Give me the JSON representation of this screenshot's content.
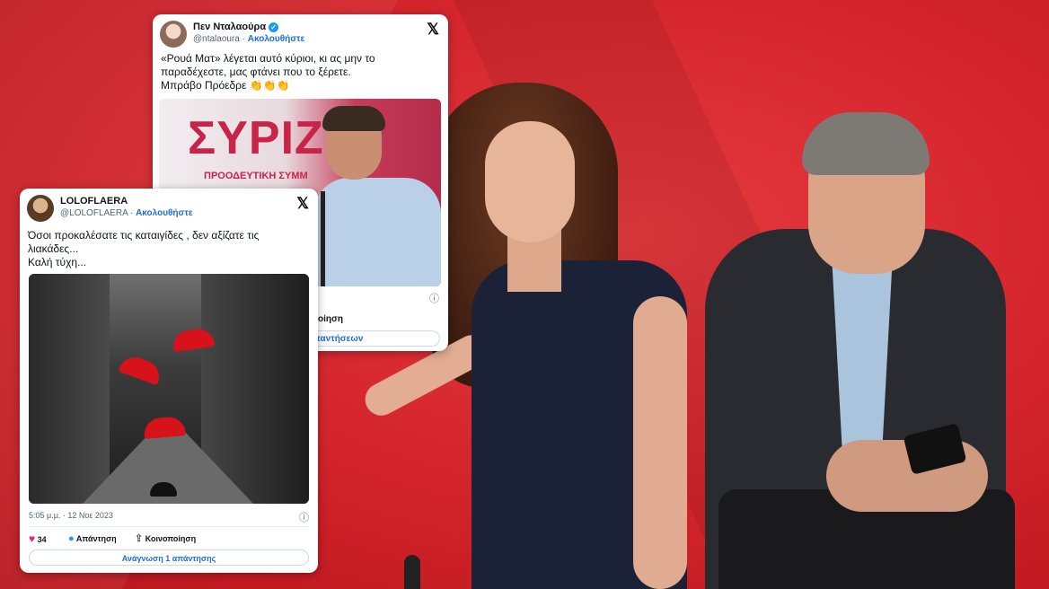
{
  "tweet1": {
    "name": "Πεν Νταλαούρα",
    "handle": "@ntalaoura",
    "separator": " · ",
    "follow": "Ακολουθήστε",
    "text_line1": "«Ρουά Ματ» λέγεται αυτό κύριοι, κι ας μην το",
    "text_line2": "παραδέχεστε, μας φτάνει που το ξέρετε.",
    "text_line3": "Μπράβο Πρόεδρε 👏👏👏",
    "media_logo": "ΣΥΡΙΖ",
    "media_sub": "ΠΡΟΟΔΕΥΤΙΚΗ ΣΥΜΜ",
    "partial_action": "ιοποίηση",
    "partial_read": "απαντήσεων",
    "x_icon": "x-logo",
    "verified_icon": "verified-badge"
  },
  "tweet2": {
    "name": "LOLOFLAERA",
    "handle": "@LOLOFLAERA",
    "separator": " · ",
    "follow": "Ακολουθήστε",
    "text_line1": "Όσοι προκαλέσατε τις καταιγίδες , δεν αξίζατε τις",
    "text_line2": "λιακάδες...",
    "text_line3": "Καλή τύχη...",
    "timestamp": "5:05 μ.μ. · 12 Νοε 2023",
    "likes": "34",
    "reply_label": "Απάντηση",
    "share_label": "Κοινοποίηση",
    "read_replies": "Ανάγνωση 1 απάντησης",
    "x_icon": "x-logo"
  },
  "colors": {
    "background": "#d9252c",
    "link": "#1d6ed6",
    "verified": "#1d9bf0",
    "like": "#f91880"
  }
}
